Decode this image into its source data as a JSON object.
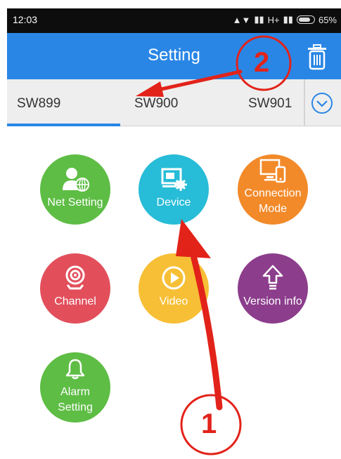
{
  "status_bar": {
    "time": "12:03",
    "network": "H+",
    "battery": "65%"
  },
  "header": {
    "title": "Setting"
  },
  "tabs": [
    {
      "label": "SW899",
      "selected": true
    },
    {
      "label": "SW900",
      "selected": false
    },
    {
      "label": "SW901",
      "selected": false
    }
  ],
  "menu": [
    {
      "label": "Net Setting",
      "color": "#5ebd45",
      "icon": "net-setting-icon"
    },
    {
      "label": "Device",
      "color": "#27bcd7",
      "icon": "device-icon"
    },
    {
      "label_line1": "Connection",
      "label_line2": "Mode",
      "color": "#f28a2a",
      "icon": "connection-mode-icon"
    },
    {
      "label": "Channel",
      "color": "#e24f5b",
      "icon": "camera-icon"
    },
    {
      "label": "Video",
      "color": "#f7bf35",
      "icon": "play-icon"
    },
    {
      "label": "Version info",
      "color": "#8c3d8c",
      "icon": "upload-arrow-icon"
    },
    {
      "label_line1": "Alarm",
      "label_line2": "Setting",
      "color": "#5ebd45",
      "icon": "bell-icon"
    }
  ],
  "annotations": {
    "one": "1",
    "two": "2",
    "color": "#e2231a"
  }
}
